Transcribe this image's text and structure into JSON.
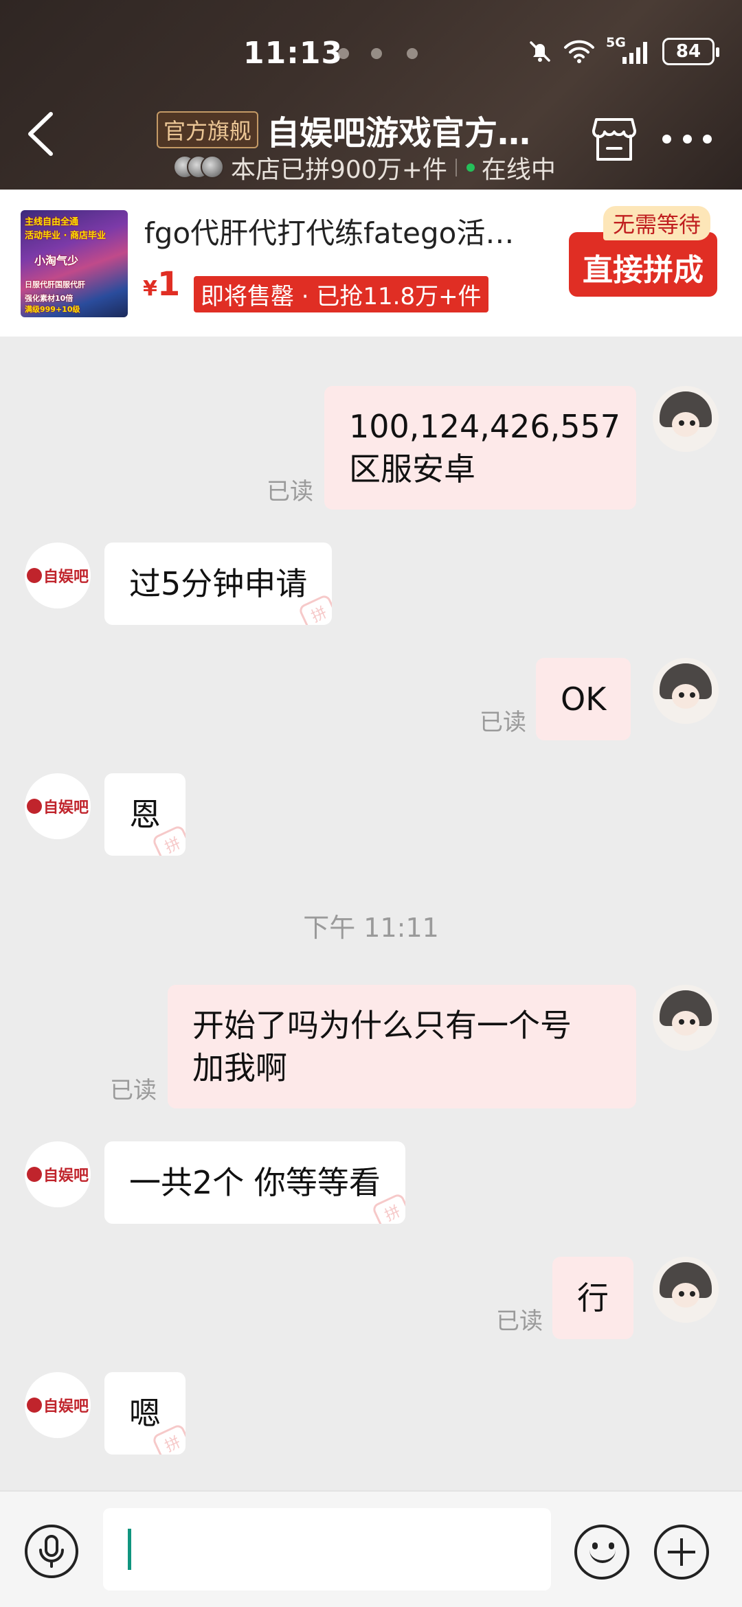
{
  "status_bar": {
    "time": "11:13",
    "battery": "84",
    "network": "5G"
  },
  "header": {
    "official_badge": "官方旗舰",
    "store_name": "自娱吧游戏官方…",
    "store_sales": "本店已拼900万+件",
    "online_status": "在线中"
  },
  "product": {
    "title": "fgo代肝代打代练fatego活…",
    "price_symbol": "¥",
    "price": "1",
    "sale_tag": "即将售罄 · 已抢11.8万+件",
    "no_wait_tag": "无需等待",
    "buy_button": "直接拼成",
    "thumb_lines": [
      "主线自由全通",
      "活动毕业 · 商店毕业",
      "小淘气少",
      "日服代肝国服代肝",
      "强化素材10倍",
      "满级999+10级"
    ]
  },
  "chat": {
    "read_label": "已读",
    "store_logo_text": "自娱吧",
    "stamp_text": "拼",
    "messages": [
      {
        "from": "me",
        "text": "100,124,426,557\n区服安卓",
        "read": true
      },
      {
        "from": "store",
        "text": "过5分钟申请"
      },
      {
        "from": "me",
        "text": "OK",
        "read": true
      },
      {
        "from": "store",
        "text": "恩"
      },
      {
        "from": "system",
        "text": "下午 11:11"
      },
      {
        "from": "me",
        "text": "开始了吗为什么只有一个号\n加我啊",
        "read": true
      },
      {
        "from": "store",
        "text": "一共2个 你等等看"
      },
      {
        "from": "me",
        "text": "行",
        "read": true
      },
      {
        "from": "store",
        "text": "嗯"
      }
    ]
  },
  "input_bar": {
    "value": "",
    "placeholder": ""
  },
  "colors": {
    "accent": "#e02e24",
    "header_bg": "#3c302b",
    "bubble_out": "#fde9e9",
    "chat_bg": "#ececec",
    "caret": "#10957f"
  }
}
